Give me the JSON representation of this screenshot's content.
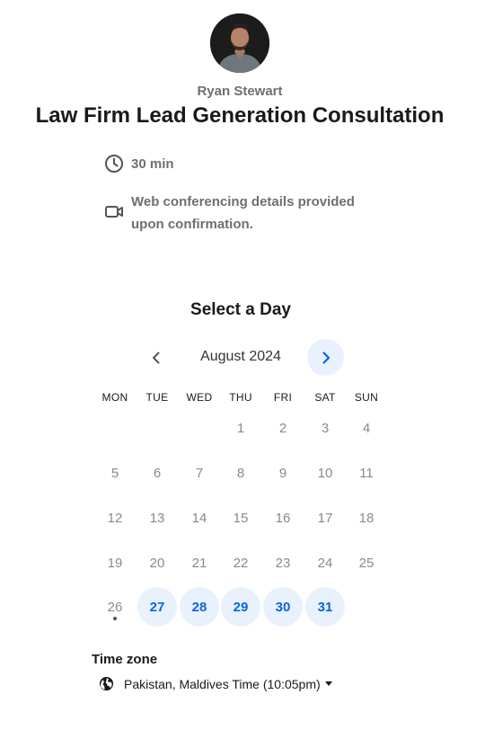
{
  "host": {
    "name": "Ryan Stewart"
  },
  "event": {
    "title": "Law Firm Lead Generation Consultation",
    "duration": "30 min",
    "location": "Web conferencing details provided upon confirmation."
  },
  "calendar": {
    "heading": "Select a Day",
    "month_label": "August 2024",
    "weekdays": [
      "MON",
      "TUE",
      "WED",
      "THU",
      "FRI",
      "SAT",
      "SUN"
    ],
    "days": [
      "1",
      "2",
      "3",
      "4",
      "5",
      "6",
      "7",
      "8",
      "9",
      "10",
      "11",
      "12",
      "13",
      "14",
      "15",
      "16",
      "17",
      "18",
      "19",
      "20",
      "21",
      "22",
      "23",
      "24",
      "25",
      "26",
      "27",
      "28",
      "29",
      "30",
      "31"
    ],
    "available_days": [
      "27",
      "28",
      "29",
      "30",
      "31"
    ],
    "today": "26",
    "first_weekday_index": 3
  },
  "timezone": {
    "label": "Time zone",
    "value": "Pakistan, Maldives Time (10:05pm)"
  },
  "colors": {
    "accent": "#0d63e0",
    "available_bg": "#e9f1fd",
    "muted_text": "#6f6f6f"
  },
  "icons": {
    "duration": "clock-icon",
    "location": "video-camera-icon",
    "prev": "chevron-left-icon",
    "next": "chevron-right-icon",
    "timezone": "globe-icon",
    "dropdown": "caret-down-icon"
  }
}
